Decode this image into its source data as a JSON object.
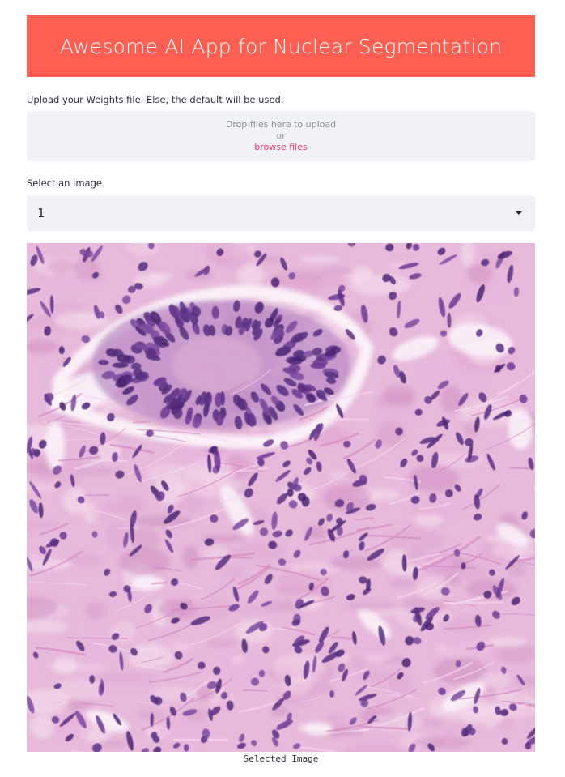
{
  "app": {
    "title": "Awesome AI App for Nuclear Segmentation",
    "accent_color": "#ff5f52"
  },
  "uploader": {
    "label": "Upload your Weights file. Else, the default will be used.",
    "drop_text": "Drop files here to upload",
    "or_text": "or",
    "browse_label": "browse files"
  },
  "selector": {
    "label": "Select an image",
    "selected_value": "1",
    "icon": "chevron-down-icon"
  },
  "image": {
    "description_icon": "histology-image",
    "caption": "Selected Image"
  }
}
